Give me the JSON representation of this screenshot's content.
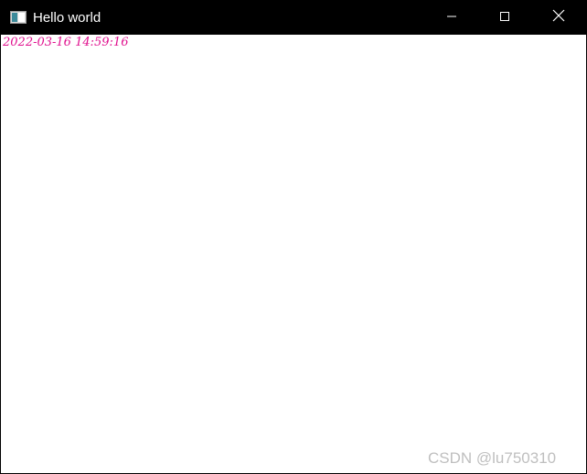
{
  "window": {
    "title": "Hello world",
    "controls": {
      "minimize": "minimize-icon",
      "maximize": "maximize-icon",
      "close": "close-icon"
    }
  },
  "content": {
    "timestamp": "2022-03-16 14:59:16",
    "timestamp_color": "#e0108e"
  },
  "watermark": {
    "text": "CSDN @lu750310"
  }
}
